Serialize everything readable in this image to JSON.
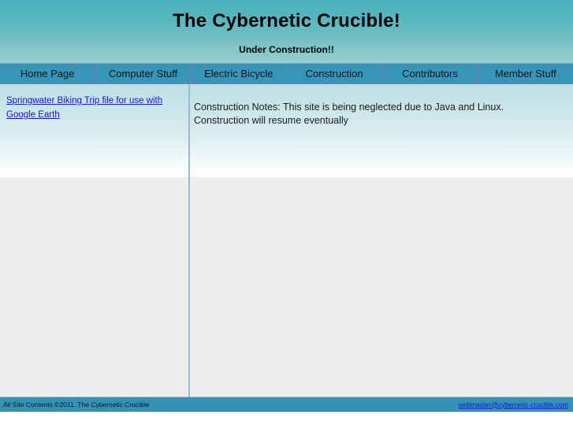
{
  "header": {
    "title": "The Cybernetic Crucible!",
    "subtitle": "Under Construction!!",
    "gradient_top": "#4bb2bd",
    "gradient_bottom": "#96cdce"
  },
  "nav": {
    "tabs": [
      {
        "label": "Home Page"
      },
      {
        "label": "Computer Stuff"
      },
      {
        "label": "Electric Bicycle"
      },
      {
        "label": "Construction"
      },
      {
        "label": "Contributors"
      },
      {
        "label": "Member Stuff"
      }
    ],
    "background": "#3795b8",
    "divider_color": "#6f7fb0"
  },
  "sidebar": {
    "links": [
      {
        "label": "Springwater Biking Trip file for use with Google Earth"
      }
    ],
    "link_color": "#1414dd"
  },
  "main": {
    "notes": "Construction Notes: This site is being neglected due to Java and Linux. Construction will resume eventually",
    "background_top": "#bfe0e5",
    "background_bottom": "#ededed"
  },
  "footer": {
    "copyright": "All Site Contents ©2011. The Cybernetic Crucible",
    "email": "webmaster@cybernetic-crucible.com",
    "background": "#3392b5"
  }
}
